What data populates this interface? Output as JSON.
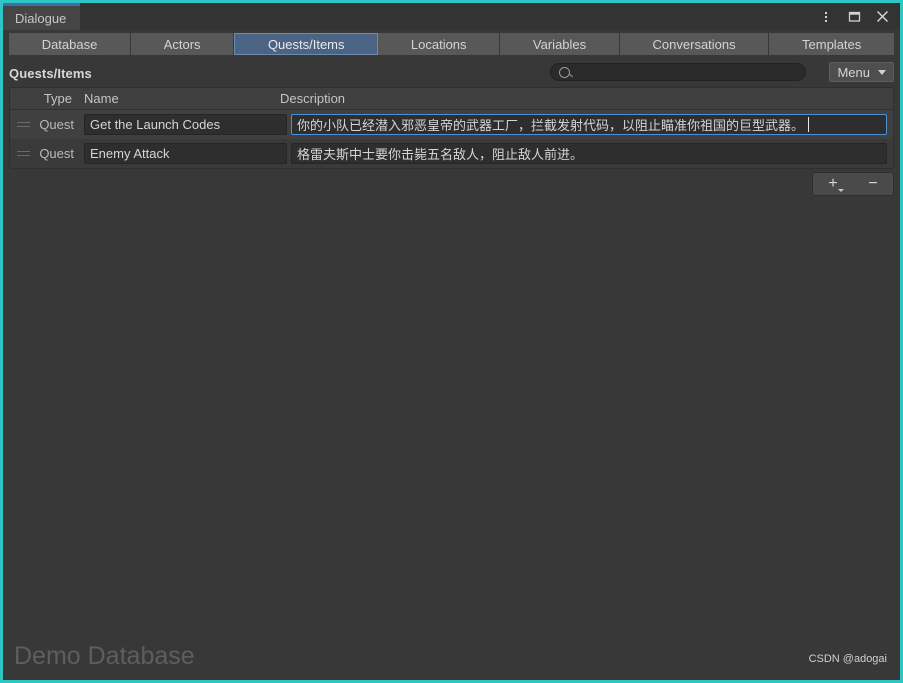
{
  "window": {
    "tab_label": "Dialogue",
    "controls": {
      "kebab": "more-options",
      "maximize": "maximize",
      "close": "close"
    }
  },
  "tabs": [
    {
      "label": "Database",
      "active": false
    },
    {
      "label": "Actors",
      "active": false
    },
    {
      "label": "Quests/Items",
      "active": true
    },
    {
      "label": "Locations",
      "active": false
    },
    {
      "label": "Variables",
      "active": false
    },
    {
      "label": "Conversations",
      "active": false
    },
    {
      "label": "Templates",
      "active": false
    }
  ],
  "section": {
    "title": "Quests/Items",
    "search": {
      "value": "",
      "placeholder": ""
    },
    "menu_label": "Menu"
  },
  "table": {
    "columns": [
      "Type",
      "Name",
      "Description"
    ],
    "rows": [
      {
        "type": "Quest",
        "name": "Get the Launch Codes",
        "description": "你的小队已经潜入邪恶皇帝的武器工厂，拦截发射代码，以阻止瞄准你祖国的巨型武器。",
        "focused": true
      },
      {
        "type": "Quest",
        "name": "Enemy Attack",
        "description": "格雷夫斯中士要你击毙五名敌人，阻止敌人前进。",
        "focused": false
      }
    ]
  },
  "list_buttons": {
    "add": "+",
    "remove": "−"
  },
  "footer": {
    "database_name": "Demo Database",
    "watermark": "CSDN @adogai"
  },
  "colors": {
    "window_border": "#2ec5c5",
    "active_tab": "#4c6484",
    "title_accent": "#3b6fa8",
    "focus_border": "#4a90d9",
    "panel_bg": "#3c3c3c"
  }
}
